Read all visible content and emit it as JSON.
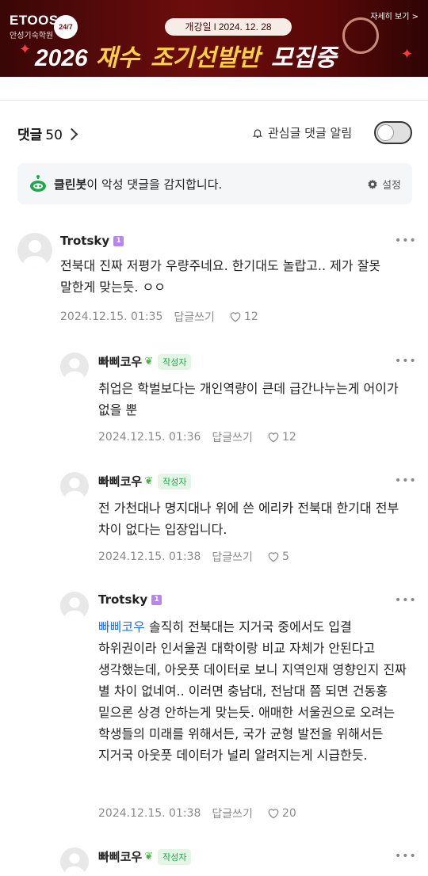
{
  "banner": {
    "brand": "ETOOS",
    "brand_sub": "안성기숙학원",
    "badge": "24/7",
    "date_pill": "개강일 l 2024. 12. 28",
    "year": "2026",
    "word_a": "재수",
    "word_b": "조기선발반",
    "word_c": "모집중",
    "more_link": "자세히 보기 >"
  },
  "comments_header": {
    "label": "댓글",
    "count": "50",
    "alert_label": "관심글 댓글 알림",
    "toggle_on": false
  },
  "cleanbot": {
    "name": "클린봇",
    "text": "이 악성 댓글을 감지합니다.",
    "settings_label": "설정"
  },
  "comments": [
    {
      "nick": "Trotsky",
      "level": "1",
      "body": "전북대 진짜 저평가 우량주네요. 한기대도 놀랍고.. 제가 잘못 말한게 맞는듯. ㅇㅇ",
      "date": "2024.12.15. 01:35",
      "reply_label": "답글쓰기",
      "likes": "12"
    },
    {
      "nick": "빠삐코우",
      "author_badge": "작성자",
      "body": "취업은 학벌보다는 개인역량이 큰데 급간나누는게 어이가 없을 뿐",
      "date": "2024.12.15. 01:36",
      "reply_label": "답글쓰기",
      "likes": "12"
    },
    {
      "nick": "빠삐코우",
      "author_badge": "작성자",
      "body": "전 가천대나 명지대나 위에 쓴 에리카 전북대 한기대 전부 차이 없다는 입장입니다.",
      "date": "2024.12.15. 01:38",
      "reply_label": "답글쓰기",
      "likes": "5"
    },
    {
      "nick": "Trotsky",
      "level": "1",
      "mention": "빠삐코우",
      "body": " 솔직히 전북대는 지거국 중에서도 입결 하위권이라 인서울권 대학이랑 비교 자체가 안된다고 생각했는데, 아웃풋 데이터로 보니 지역인재 영향인지 진짜 별 차이 없네여.. 이러면 충남대, 전남대 쯤 되면 건동홍 밑으론 상경 안하는게 맞는듯. 애매한 서울권으로 오려는 학생들의 미래를 위해서든, 국가 균형 발전을 위해서든 지거국 아웃풋 데이터가 널리 알려지는게 시급한듯.",
      "date": "2024.12.15. 01:38",
      "reply_label": "답글쓰기",
      "likes": "20"
    },
    {
      "nick": "빠삐코우",
      "author_badge": "작성자"
    }
  ],
  "colors": {
    "accent_green": "#1fa84a",
    "mention_blue": "#1a73e8",
    "level_purple": "#b784f0"
  }
}
